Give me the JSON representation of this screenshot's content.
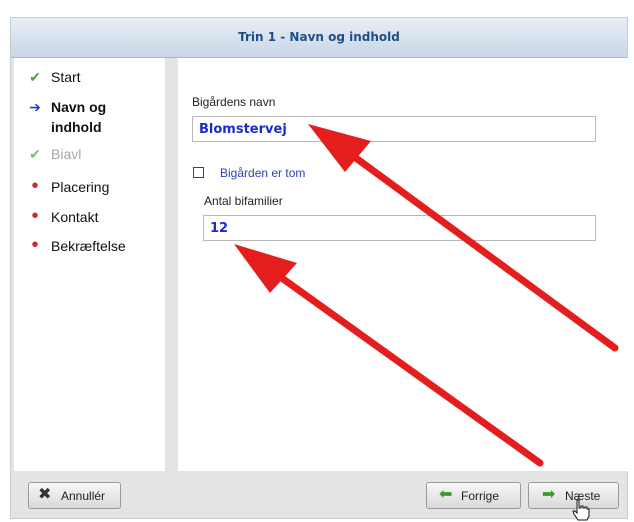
{
  "wizard": {
    "title": "Trin 1 - Navn og indhold"
  },
  "steps": [
    {
      "label": "Start",
      "state": "done",
      "icon": "check-icon"
    },
    {
      "label": "Navn og indhold",
      "state": "active",
      "icon": "arrow-right-icon"
    },
    {
      "label": "Biavl",
      "state": "done-grey",
      "icon": "check-icon"
    },
    {
      "label": "Placering",
      "state": "pending",
      "icon": "bullet-icon"
    },
    {
      "label": "Kontakt",
      "state": "pending",
      "icon": "bullet-icon"
    },
    {
      "label": "Bekræftelse",
      "state": "pending",
      "icon": "bullet-icon"
    }
  ],
  "form": {
    "name_label": "Bigårdens navn",
    "name_value": "Blomstervej",
    "empty_checkbox_label": "Bigården er tom",
    "empty_checked": false,
    "colonies_label": "Antal bifamilier",
    "colonies_value": "12"
  },
  "footer": {
    "cancel_label": "Annullér",
    "prev_label": "Forrige",
    "next_label": "Næste"
  },
  "colors": {
    "accent_blue": "#1c2bd0",
    "annotation_arrow": "#e41e1e",
    "check_green": "#52a33e",
    "nav_arrow_green": "#3a9a2c",
    "bullet_red": "#d8232a"
  }
}
